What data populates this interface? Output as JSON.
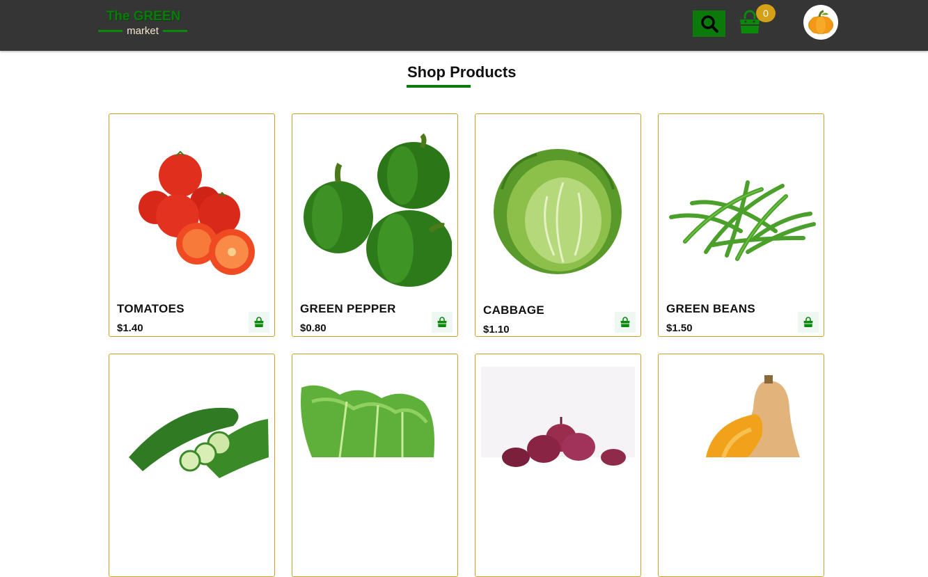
{
  "header": {
    "logo_title": "The GREEN",
    "logo_sub": "market",
    "search_icon": "search-icon",
    "cart_icon": "shopping-bag-icon",
    "cart_count": "0",
    "avatar_icon": "pumpkin-avatar"
  },
  "page": {
    "title": "Shop Products"
  },
  "colors": {
    "header_bg": "#353535",
    "accent_green": "#0a7a0a",
    "badge": "#d4a017",
    "card_border": "#c9a227"
  },
  "products": [
    {
      "name": "TOMATOES",
      "price": "$1.40",
      "image": "tomatoes"
    },
    {
      "name": "GREEN PEPPER",
      "price": "$0.80",
      "image": "green-pepper"
    },
    {
      "name": "CABBAGE",
      "price": "$1.10",
      "image": "cabbage"
    },
    {
      "name": "GREEN BEANS",
      "price": "$1.50",
      "image": "green-beans"
    },
    {
      "image": "cucumber"
    },
    {
      "image": "lettuce"
    },
    {
      "image": "red-onions"
    },
    {
      "image": "butternut-squash"
    }
  ]
}
